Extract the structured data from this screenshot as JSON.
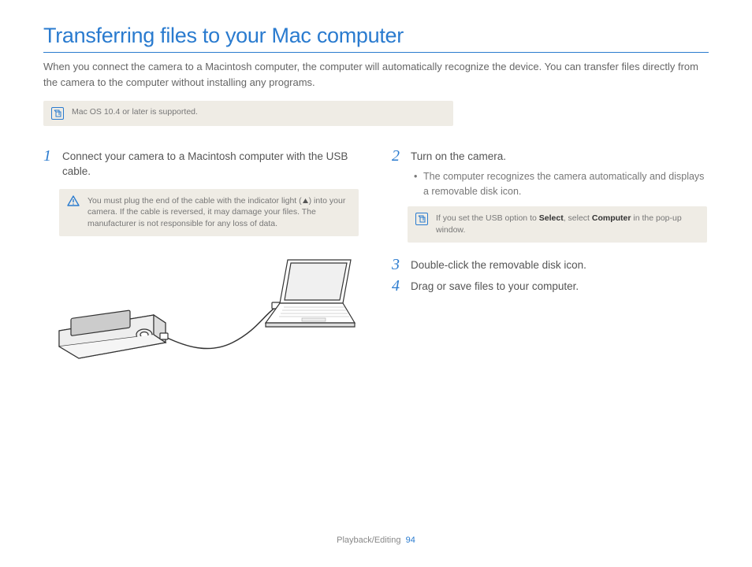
{
  "title": "Transferring files to your Mac computer",
  "intro": "When you connect the camera to a Macintosh computer, the computer will automatically recognize the device. You can transfer files directly from the camera to the computer without installing any programs.",
  "top_note": "Mac OS 10.4 or later is supported.",
  "left": {
    "step1_num": "1",
    "step1_text": "Connect your camera to a Macintosh computer with the USB cable.",
    "warn_pre": "You must plug the end of the cable with the indicator light (",
    "warn_post": ") into your camera. If the cable is reversed, it may damage your files. The manufacturer is not responsible for any loss of data."
  },
  "right": {
    "step2_num": "2",
    "step2_text": "Turn on the camera.",
    "step2_bullet": "The computer recognizes the camera automatically and displays a removable disk icon.",
    "note2_pre": "If you set the USB option to ",
    "note2_b1": "Select",
    "note2_mid": ", select ",
    "note2_b2": "Computer",
    "note2_post": " in the pop-up window.",
    "step3_num": "3",
    "step3_text": "Double-click the removable disk icon.",
    "step4_num": "4",
    "step4_text": "Drag or save files to your computer."
  },
  "footer": {
    "section": "Playback/Editing",
    "page": "94"
  }
}
